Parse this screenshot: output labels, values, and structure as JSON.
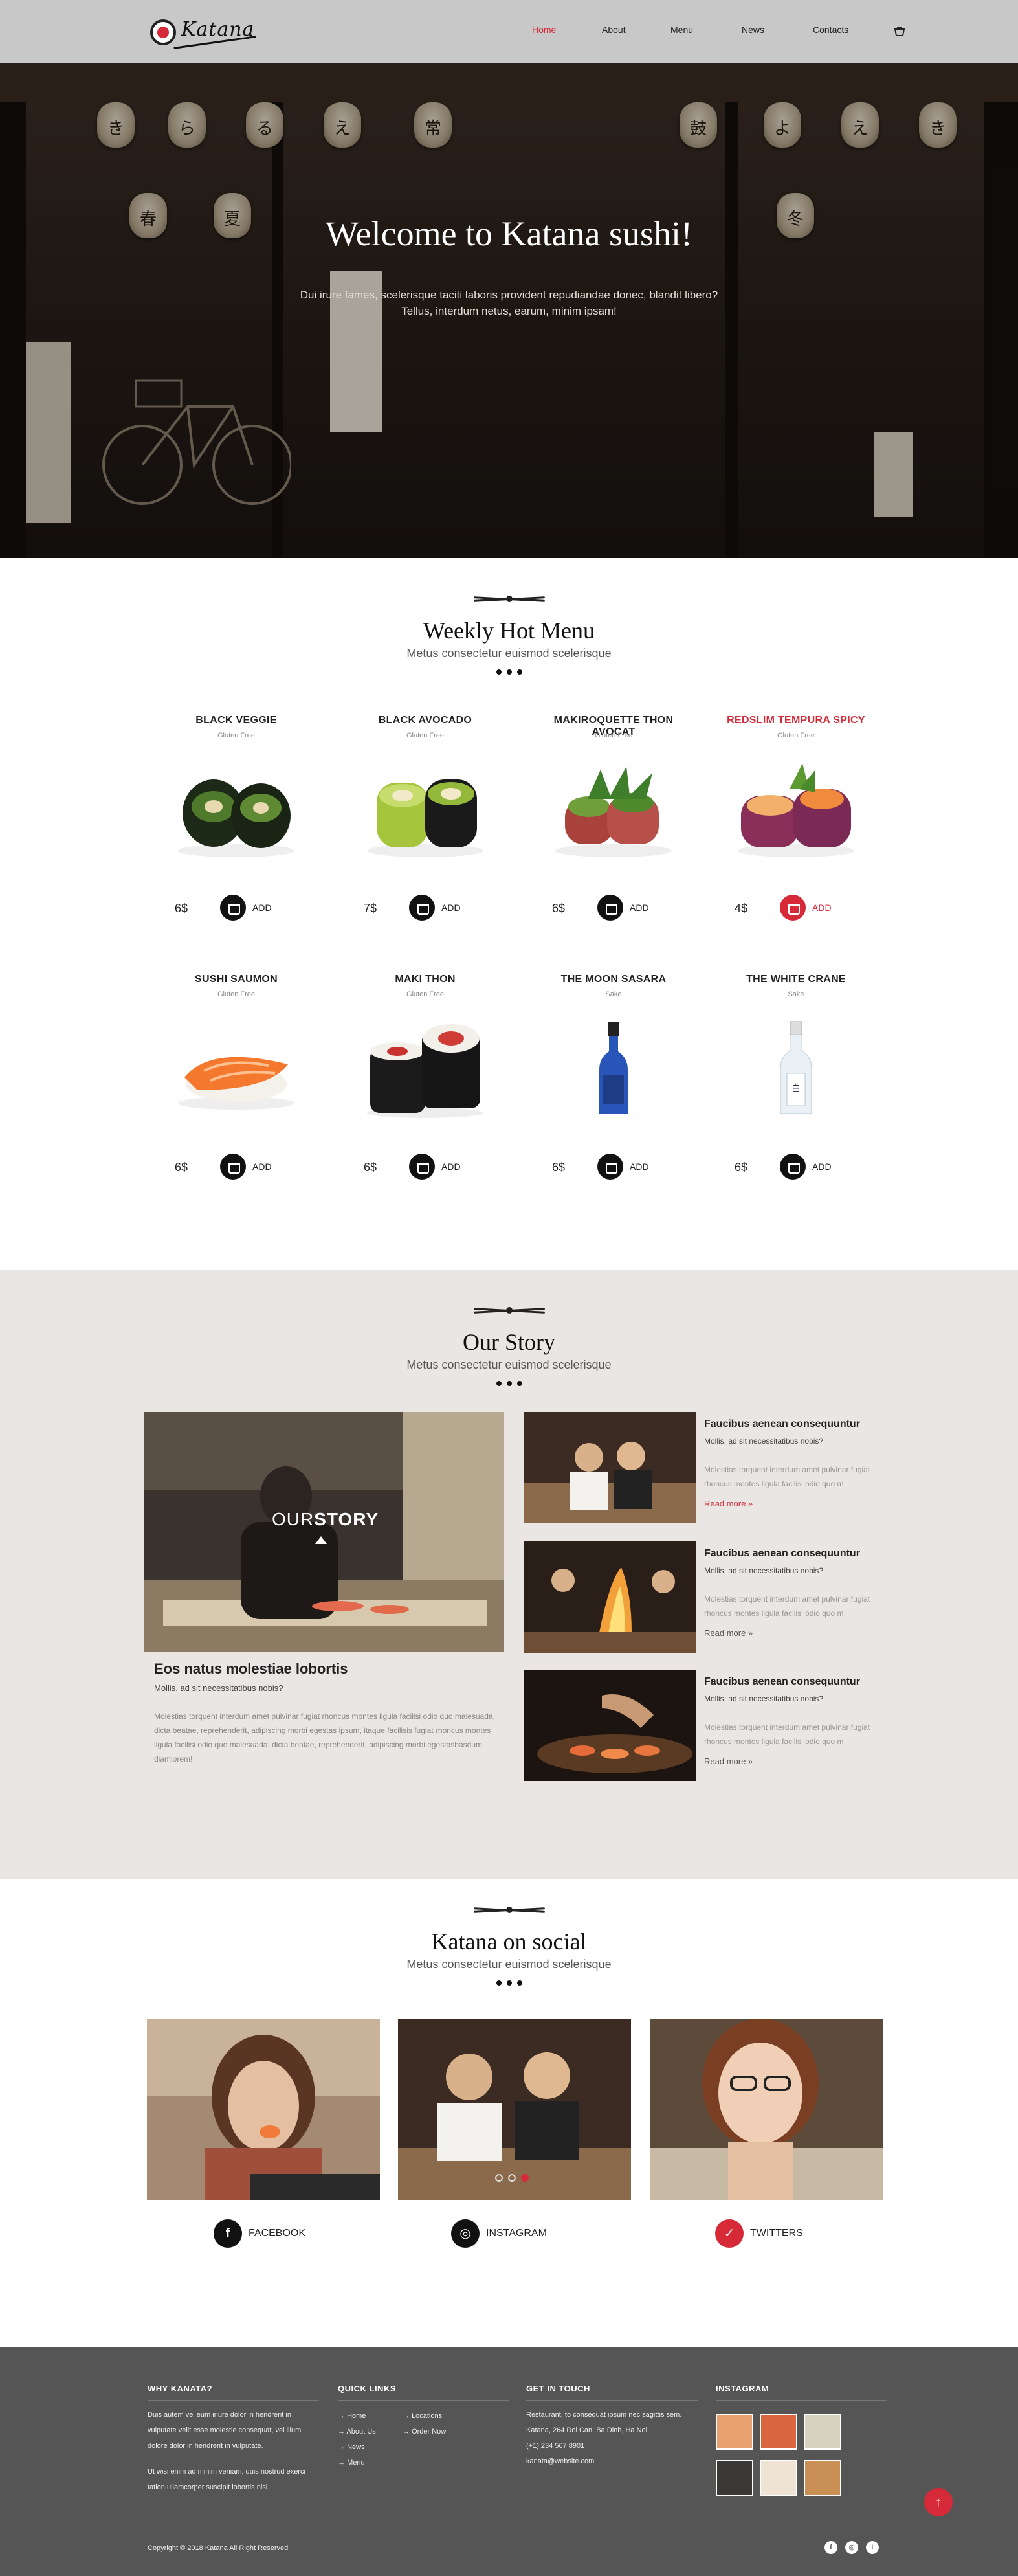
{
  "header": {
    "logo_text": "Katana",
    "nav": [
      "Home",
      "About",
      "Menu",
      "News",
      "Contacts"
    ],
    "active": "Home"
  },
  "hero": {
    "title": "Welcome to Katana sushi!",
    "subtitle_line1": "Dui irure fames, scelerisque taciti laboris provident repudiandae donec, blandit libero?",
    "subtitle_line2": "Tellus, interdum netus, earum, minim ipsam!"
  },
  "weekly_menu": {
    "title": "Weekly Hot Menu",
    "subtitle": "Metus consectetur euismod scelerisque",
    "add_label": "ADD",
    "items": [
      {
        "name": "BLACK VEGGIE",
        "tag": "Gluten Free",
        "price": "6$"
      },
      {
        "name": "BLACK AVOCADO",
        "tag": "Gluten Free",
        "price": "7$"
      },
      {
        "name": "MAKIROQUETTE THON AVOCAT",
        "tag": "Gluten Free",
        "price": "6$"
      },
      {
        "name": "REDSLIM TEMPURA SPICY",
        "tag": "Gluten Free",
        "price": "4$"
      },
      {
        "name": "SUSHI SAUMON",
        "tag": "Gluten Free",
        "price": "6$"
      },
      {
        "name": "MAKI THON",
        "tag": "Gluten Free",
        "price": "6$"
      },
      {
        "name": "THE MOON SASARA",
        "tag": "Sake",
        "price": "6$"
      },
      {
        "name": "THE WHITE CRANE",
        "tag": "Sake",
        "price": "6$"
      }
    ]
  },
  "story": {
    "title": "Our Story",
    "subtitle": "Metus consectetur euismod scelerisque",
    "overlay_light": "OUR",
    "overlay_bold": "STORY",
    "main_title": "Eos natus molestiae lobortis",
    "main_question": "Mollis, ad sit necessitatibus nobis?",
    "main_body": "Molestias torquent interdum amet pulvinar fugiat rhoncus montes ligula facilisi odio quo malesuada, dicta beatae, reprehenderit, adipiscing morbi egestas ipsum, itaque facilisis fugiat rhoncus montes ligula facilisi odio quo malesuada, dicta beatae, reprehenderit, adipiscing morbi egestasbasdum diamlorem!",
    "side_items": [
      {
        "title": "Faucibus aenean consequuntur",
        "question": "Mollis, ad sit necessitatibus nobis?",
        "text": "Molestias torquent interdum amet pulvinar fugiat rhoncus montes ligula facilisi odio quo m",
        "more": "Read more"
      },
      {
        "title": "Faucibus aenean consequuntur",
        "question": "Mollis, ad sit necessitatibus nobis?",
        "text": "Molestias torquent interdum amet pulvinar fugiat rhoncus montes ligula facilisi odio quo m",
        "more": "Read more"
      },
      {
        "title": "Faucibus aenean consequuntur",
        "question": "Mollis, ad sit necessitatibus nobis?",
        "text": "Molestias torquent interdum amet pulvinar fugiat rhoncus montes ligula facilisi odio quo m",
        "more": "Read more"
      }
    ]
  },
  "social": {
    "title": "Katana on social",
    "subtitle": "Metus consectetur euismod scelerisque",
    "facebook": "FACEBOOK",
    "instagram": "INSTAGRAM",
    "twitter": "TWITTERS"
  },
  "footer": {
    "why_title": "WHY KANATA?",
    "why_p1": "Duis autem vel eum iriure dolor in hendrerit in vulputate velit esse molestie consequat, vel illum dolore dolor in hendrerit in vulputate.",
    "why_p2": "Ut wisi enim ad minim veniam, quis nostrud exerci tation ullamcorper suscipit lobortis nisl.",
    "links_title": "QUICK LINKS",
    "links_col1": [
      "Home",
      "About Us",
      "News",
      "Menu"
    ],
    "links_col2": [
      "Locations",
      "Order Now"
    ],
    "touch_title": "GET IN TOUCH",
    "touch_lines": [
      "Restaurant, to consequat ipsum nec sagittis sem.",
      "Katana, 264 Doi Can, Ba Dinh, Ha Noi",
      "(+1) 234 567 8901",
      "kanata@website.com"
    ],
    "insta_title": "INSTAGRAM",
    "copyright": "Copyright © 2018 Katana All Right Reserved"
  },
  "colors": {
    "accent": "#d62a38",
    "header_bg": "#c8c8c8",
    "story_bg": "#e9e6e4",
    "footer_bg": "#555555"
  }
}
